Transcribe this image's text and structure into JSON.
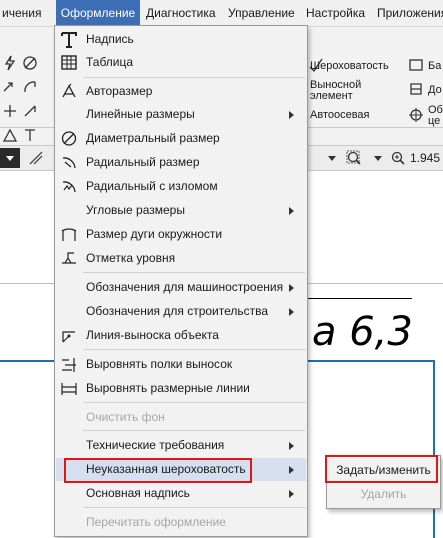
{
  "menubar": {
    "items": [
      "ичения",
      "Оформление",
      "Диагностика",
      "Управление",
      "Настройка",
      "Приложения"
    ]
  },
  "ribbon": {
    "roughness": "Шероховатость",
    "leader_1": "Выносной",
    "leader_2": "элемент",
    "axial": "Автоосевая",
    "cut_1": "Ба",
    "cut_2": "До",
    "cut_3": "Об",
    "cut_4": "це"
  },
  "toolbar": {
    "zoom_value": "1.945"
  },
  "canvas": {
    "text": "а 6,3"
  },
  "dropdown": {
    "items": [
      {
        "label": "Надпись",
        "icon": "text-T-icon",
        "submenu": false,
        "disabled": false
      },
      {
        "label": "Таблица",
        "icon": "table-icon",
        "submenu": false,
        "disabled": false
      },
      {
        "label": "Авторазмер",
        "icon": "autosize-icon",
        "submenu": false,
        "disabled": false
      },
      {
        "label": "Линейные размеры",
        "icon": "",
        "submenu": true,
        "disabled": false
      },
      {
        "label": "Диаметральный размер",
        "icon": "diameter-icon",
        "submenu": false,
        "disabled": false
      },
      {
        "label": "Радиальный размер",
        "icon": "radius-icon",
        "submenu": false,
        "disabled": false
      },
      {
        "label": "Радиальный с изломом",
        "icon": "radius-break-icon",
        "submenu": false,
        "disabled": false
      },
      {
        "label": "Угловые размеры",
        "icon": "",
        "submenu": true,
        "disabled": false
      },
      {
        "label": "Размер дуги окружности",
        "icon": "arc-size-icon",
        "submenu": false,
        "disabled": false
      },
      {
        "label": "Отметка уровня",
        "icon": "level-mark-icon",
        "submenu": false,
        "disabled": false
      },
      {
        "label": "Обозначения для машиностроения",
        "icon": "",
        "submenu": true,
        "disabled": false
      },
      {
        "label": "Обозначения для строительства",
        "icon": "",
        "submenu": true,
        "disabled": false
      },
      {
        "label": "Линия-выноска объекта",
        "icon": "leader-line-icon",
        "submenu": false,
        "disabled": false
      },
      {
        "label": "Выровнять полки выносок",
        "icon": "align-shelves-icon",
        "submenu": false,
        "disabled": false
      },
      {
        "label": "Выровнять размерные линии",
        "icon": "align-dim-lines-icon",
        "submenu": false,
        "disabled": false
      },
      {
        "label": "Очистить фон",
        "icon": "",
        "submenu": false,
        "disabled": true
      },
      {
        "label": "Технические требования",
        "icon": "",
        "submenu": true,
        "disabled": false
      },
      {
        "label": "Неуказанная шероховатость",
        "icon": "",
        "submenu": true,
        "disabled": false
      },
      {
        "label": "Основная надпись",
        "icon": "",
        "submenu": true,
        "disabled": false
      },
      {
        "label": "Перечитать оформление",
        "icon": "",
        "submenu": false,
        "disabled": true
      }
    ]
  },
  "submenu": {
    "items": [
      {
        "label": "Задать/изменить",
        "disabled": false
      },
      {
        "label": "Удалить",
        "disabled": true
      }
    ]
  },
  "colors": {
    "menu_active_bg": "#3d6db5",
    "highlight_box": "#e01515",
    "canvas_blue_line": "#1d6fae"
  }
}
